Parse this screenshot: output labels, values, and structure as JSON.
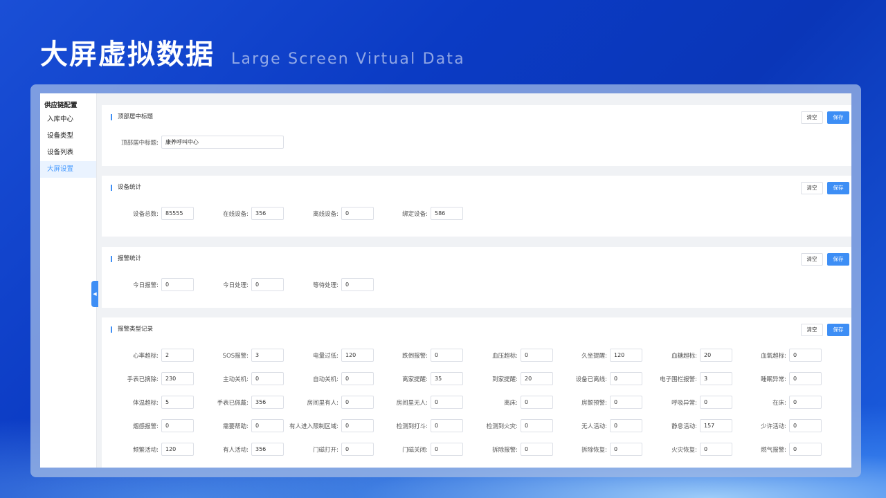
{
  "header": {
    "title_cn": "大屏虚拟数据",
    "title_en": "Large Screen Virtual Data"
  },
  "sidebar": {
    "group": "供应链配置",
    "items": [
      {
        "label": "入库中心",
        "active": false
      },
      {
        "label": "设备类型",
        "active": false
      },
      {
        "label": "设备列表",
        "active": false
      },
      {
        "label": "大屏设置",
        "active": true
      }
    ]
  },
  "buttons": {
    "clear": "清空",
    "save": "保存"
  },
  "sections": {
    "top_title": {
      "title": "顶部居中标题",
      "fields": [
        {
          "label": "顶部居中标题:",
          "value": "康养呼叫中心"
        }
      ]
    },
    "device_stats": {
      "title": "设备统计",
      "fields": [
        {
          "label": "设备总数:",
          "value": "85555"
        },
        {
          "label": "在线设备:",
          "value": "356"
        },
        {
          "label": "离线设备:",
          "value": "0"
        },
        {
          "label": "绑定设备:",
          "value": "586"
        }
      ]
    },
    "alarm_stats": {
      "title": "报警统计",
      "fields": [
        {
          "label": "今日报警:",
          "value": "0"
        },
        {
          "label": "今日处理:",
          "value": "0"
        },
        {
          "label": "等待处理:",
          "value": "0"
        }
      ]
    },
    "alarm_types": {
      "title": "报警类型记录",
      "rows": [
        [
          {
            "label": "心率超标:",
            "value": "2"
          },
          {
            "label": "SOS报警:",
            "value": "3"
          },
          {
            "label": "电量过低:",
            "value": "120"
          },
          {
            "label": "跌倒报警:",
            "value": "0"
          },
          {
            "label": "血压超标:",
            "value": "0"
          },
          {
            "label": "久坐提醒:",
            "value": "120"
          },
          {
            "label": "血糖超标:",
            "value": "20"
          },
          {
            "label": "血氧超标:",
            "value": "0"
          }
        ],
        [
          {
            "label": "手表已摘除:",
            "value": "230"
          },
          {
            "label": "主动关机:",
            "value": "0"
          },
          {
            "label": "自动关机:",
            "value": "0"
          },
          {
            "label": "离家提醒:",
            "value": "35"
          },
          {
            "label": "到家提醒:",
            "value": "20"
          },
          {
            "label": "设备已离线:",
            "value": "0"
          },
          {
            "label": "电子围栏报警:",
            "value": "3"
          },
          {
            "label": "睡眠异常:",
            "value": "0"
          }
        ],
        [
          {
            "label": "体温超标:",
            "value": "5"
          },
          {
            "label": "手表已佩戴:",
            "value": "356"
          },
          {
            "label": "房间里有人:",
            "value": "0"
          },
          {
            "label": "房间里无人:",
            "value": "0"
          },
          {
            "label": "离床:",
            "value": "0"
          },
          {
            "label": "房颤预警:",
            "value": "0"
          },
          {
            "label": "呼吸异常:",
            "value": "0"
          },
          {
            "label": "在床:",
            "value": "0"
          }
        ],
        [
          {
            "label": "烟感报警:",
            "value": "0"
          },
          {
            "label": "需要帮助:",
            "value": "0"
          },
          {
            "label": "有人进入限制区域:",
            "value": "0"
          },
          {
            "label": "检测到打斗:",
            "value": "0"
          },
          {
            "label": "检测到火灾:",
            "value": "0"
          },
          {
            "label": "无人活动:",
            "value": "0"
          },
          {
            "label": "静息活动:",
            "value": "157"
          },
          {
            "label": "少许活动:",
            "value": "0"
          }
        ],
        [
          {
            "label": "频繁活动:",
            "value": "120"
          },
          {
            "label": "有人活动:",
            "value": "356"
          },
          {
            "label": "门磁打开:",
            "value": "0"
          },
          {
            "label": "门磁关闭:",
            "value": "0"
          },
          {
            "label": "拆除报警:",
            "value": "0"
          },
          {
            "label": "拆除恢复:",
            "value": "0"
          },
          {
            "label": "火灾恢复:",
            "value": "0"
          },
          {
            "label": "燃气报警:",
            "value": "0"
          }
        ]
      ]
    }
  }
}
